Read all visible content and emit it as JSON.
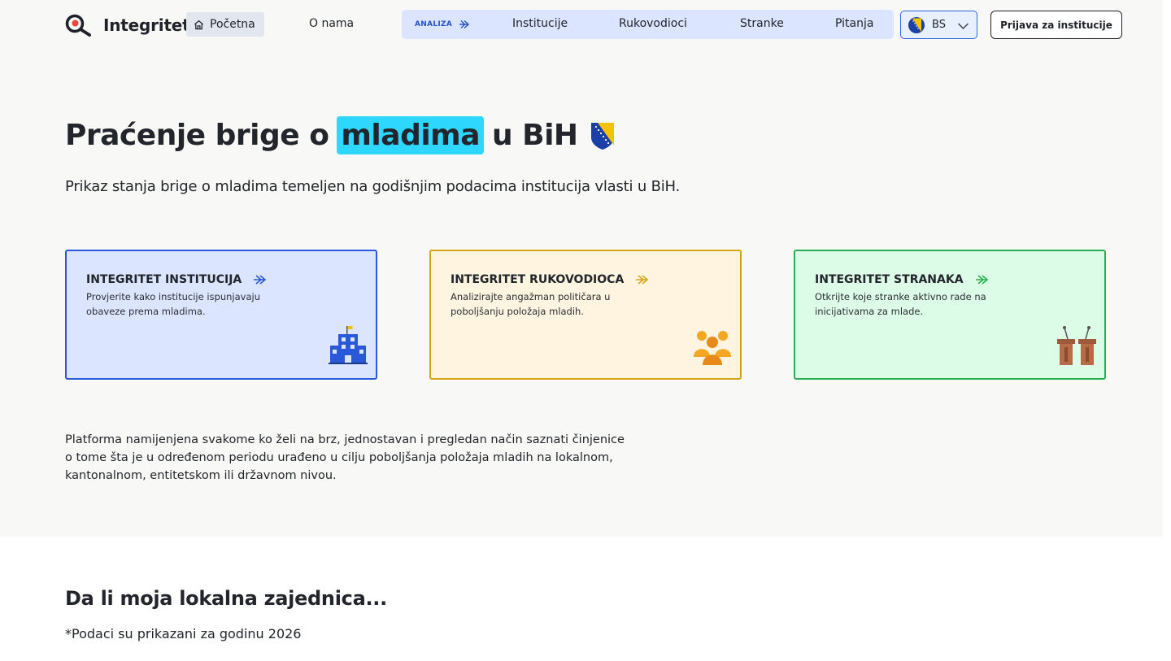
{
  "header": {
    "logo_text": "Integritet",
    "nav_home_label": "Početna",
    "nav_about_label": "O nama",
    "analiza_label": "ANALIZA",
    "analiza_links": [
      "Institucije",
      "Rukovodioci",
      "Stranke",
      "Pitanja"
    ],
    "language": "BS",
    "login_label": "Prijava za institucije"
  },
  "hero": {
    "title_before": "Praćenje brige o",
    "title_highlight": "mladima",
    "title_after": "u BiH",
    "subtitle": "Prikaz stanja brige o mladima temeljen na godišnjim podacima institucija vlasti u BiH."
  },
  "cards": [
    {
      "title": "INTEGRITET INSTITUCIJA",
      "description": "Provjerite kako institucije ispunjavaju obaveze prema mladima.",
      "icon": "building-icon"
    },
    {
      "title": "INTEGRITET RUKOVODIOCA",
      "description": "Analizirajte angažman političara u poboljšanju položaja mladih.",
      "icon": "people-icon"
    },
    {
      "title": "INTEGRITET STRANAKA",
      "description": "Otkrijte koje stranke aktivno rade na inicijativama za mlade.",
      "icon": "podium-icon"
    }
  ],
  "platform_description": "Platforma namijenjena svakome ko želi na brz, jednostavan i pregledan način saznati činjenice o tome šta je u određenom periodu urađeno u cilju poboljšanja položaja mladih na lokalnom, kantonalnom, entitetskom ili državnom nivou.",
  "section": {
    "title": "Da li moja lokalna zajednica...",
    "note": "*Podaci su prikazani za godinu 2026"
  },
  "colors": {
    "highlight": "#2ed7ff",
    "institucije_accent": "#2959d9",
    "rukovodioci_accent": "#d4a316",
    "stranke_accent": "#24b04f",
    "nav_bar": "#dbe5ff"
  }
}
